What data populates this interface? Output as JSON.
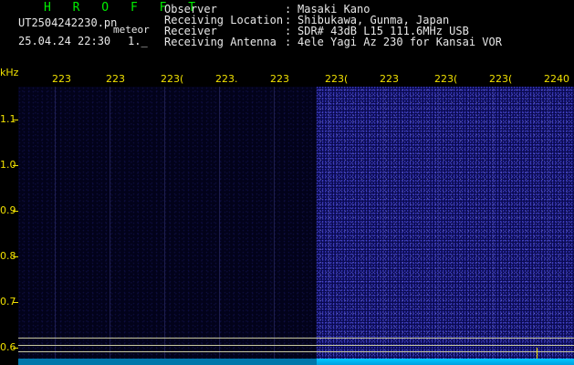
{
  "header": {
    "program": "H R O F F T",
    "filename": "UT2504242230.pn",
    "filename_tag": "meteor",
    "timestamp": "25.04.24 22:30",
    "timestamp_extra": "1._"
  },
  "info": [
    {
      "label": "Observer",
      "value": "Masaki Kano"
    },
    {
      "label": "Receiving Location",
      "value": "Shibukawa, Gunma, Japan"
    },
    {
      "label": "Receiver",
      "value": "SDR# 43dB L15 111.6MHz USB"
    },
    {
      "label": "Receiving Antenna",
      "value": "4ele Yagi Az 230 for Kansai VOR"
    }
  ],
  "info_separator": ":",
  "axis": {
    "unit": "kHz",
    "y_ticks": [
      "1.1",
      "1.0",
      "0.9",
      "0.8",
      "0.7",
      "0.6"
    ],
    "x_ticks": [
      "223",
      "223",
      "223(",
      "223.",
      "223",
      "223(",
      "223",
      "223(",
      "223(",
      "2240"
    ]
  },
  "colors": {
    "label_yellow": "#f0e000",
    "header_green": "#00ee00",
    "text_white": "#e8e8e8",
    "waterfall_dim": "#02021a",
    "waterfall_bright": "#0a0a50",
    "trace_cyan": "#00c8ff"
  }
}
